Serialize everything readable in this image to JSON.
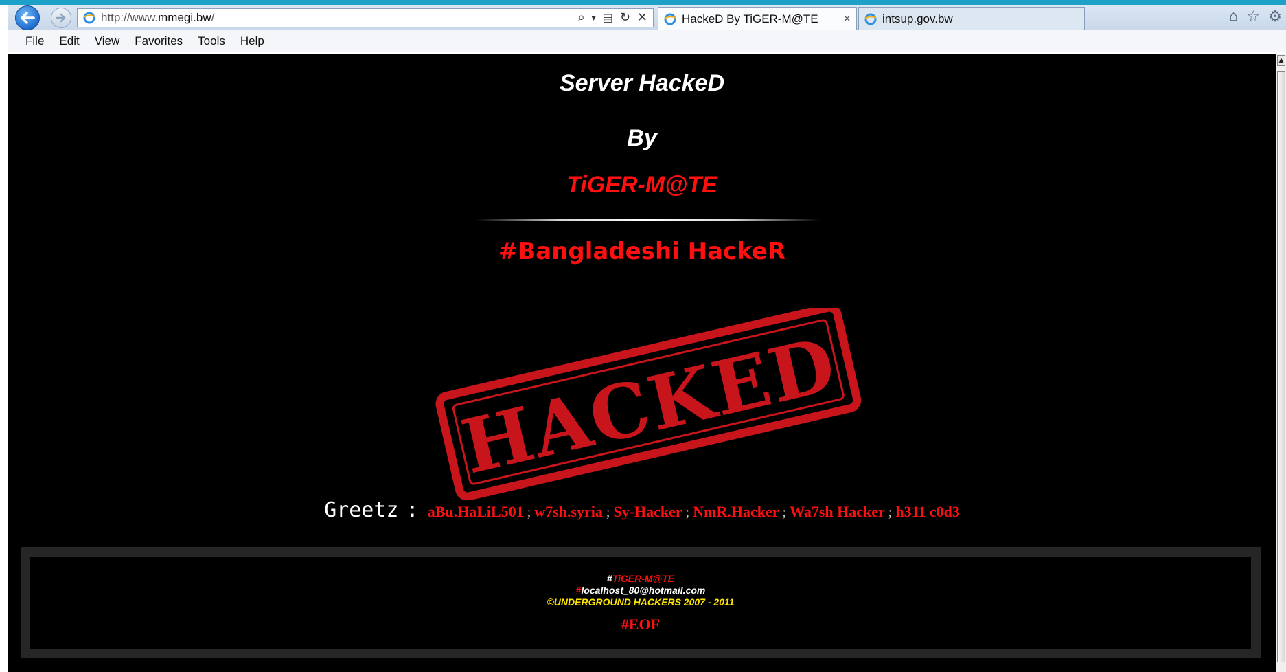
{
  "browser": {
    "url_prefix": "http://www.",
    "url_domain": "mmegi.bw",
    "url_suffix": "/",
    "tabs": [
      {
        "label": "HackeD By TiGER-M@TE",
        "active": true
      },
      {
        "label": "intsup.gov.bw",
        "active": false
      }
    ],
    "tab_close": "×",
    "menu": [
      "File",
      "Edit",
      "View",
      "Favorites",
      "Tools",
      "Help"
    ]
  },
  "page": {
    "title_line1": "Server HackeD",
    "title_line2": "By",
    "title_line3": "TiGER-M@TE",
    "subtitle": "#Bangladeshi HackeR",
    "stamp_text": "HACKED",
    "greetz_label": "Greetz",
    "greetz_colon": ":",
    "greetz_names": [
      "aBu.HaLiL501",
      "w7sh.syria",
      "Sy-Hacker",
      "NmR.Hacker",
      "Wa7sh Hacker",
      "h311 c0d3"
    ],
    "greetz_separator": ";",
    "footer": {
      "hash1": "#",
      "name": "TiGER-M@TE",
      "hash2": "#",
      "email": "localhost_80@hotmail.com",
      "copyright": "©UNDERGROUND HACKERS 2007 - 2011",
      "eof": "#EOF"
    }
  },
  "colors": {
    "accent_red": "#ff1010",
    "background": "#000000",
    "footer_yellow": "#ffe600"
  }
}
